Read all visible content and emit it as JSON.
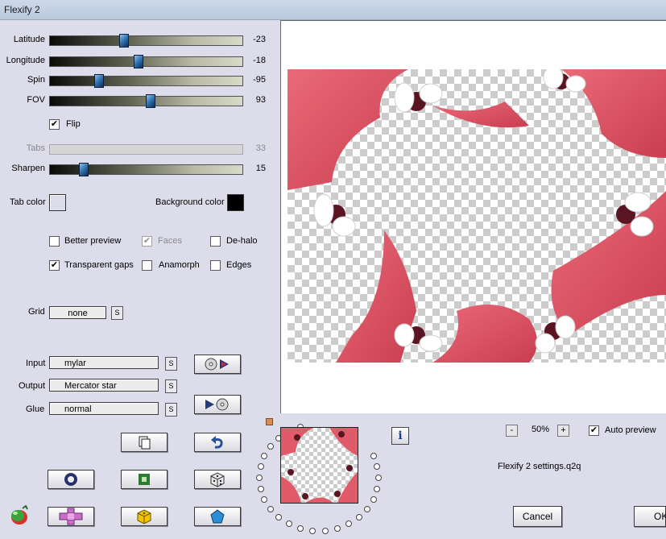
{
  "window": {
    "title": "Flexify 2"
  },
  "sliders": [
    {
      "label": "Latitude",
      "value": "-23",
      "position": 0.38,
      "enabled": true
    },
    {
      "label": "Longitude",
      "value": "-18",
      "position": 0.455,
      "enabled": true
    },
    {
      "label": "Spin",
      "value": "-95",
      "position": 0.25,
      "enabled": true
    },
    {
      "label": "FOV",
      "value": "93",
      "position": 0.52,
      "enabled": true
    },
    {
      "label": "Tabs",
      "value": "33",
      "position": 0.0,
      "enabled": false
    },
    {
      "label": "Sharpen",
      "value": "15",
      "position": 0.17,
      "enabled": true
    }
  ],
  "flip": {
    "label": "Flip",
    "checked": true
  },
  "colors": {
    "tab_color_label": "Tab color",
    "tab_color": "#dcdcea",
    "background_color_label": "Background color",
    "background_color": "#000000"
  },
  "options": {
    "better_preview": {
      "label": "Better preview",
      "checked": false
    },
    "faces": {
      "label": "Faces",
      "checked": true,
      "enabled": false
    },
    "de_halo": {
      "label": "De-halo",
      "checked": false
    },
    "transparent_gaps": {
      "label": "Transparent gaps",
      "checked": true
    },
    "anamorph": {
      "label": "Anamorph",
      "checked": false
    },
    "edges": {
      "label": "Edges",
      "checked": false
    }
  },
  "grid": {
    "label": "Grid",
    "value": "none",
    "s_label": "S"
  },
  "input": {
    "label": "Input",
    "value": "mylar",
    "s_label": "S"
  },
  "output": {
    "label": "Output",
    "value": "Mercator star",
    "s_label": "S"
  },
  "glue": {
    "label": "Glue",
    "value": "normal",
    "s_label": "S"
  },
  "zoom": {
    "minus": "-",
    "value": "50%",
    "plus": "+"
  },
  "auto_preview": {
    "label": "Auto preview",
    "checked": true
  },
  "settings_file": "Flexify 2 settings.q2q",
  "info_label": "i",
  "buttons": {
    "cancel": "Cancel",
    "ok": "OK"
  },
  "check_mark": "✔",
  "accent_colors": {
    "shape_pink": "#e05a69",
    "shape_dark": "#5a1422",
    "icon_blue": "#2a6fb8"
  }
}
